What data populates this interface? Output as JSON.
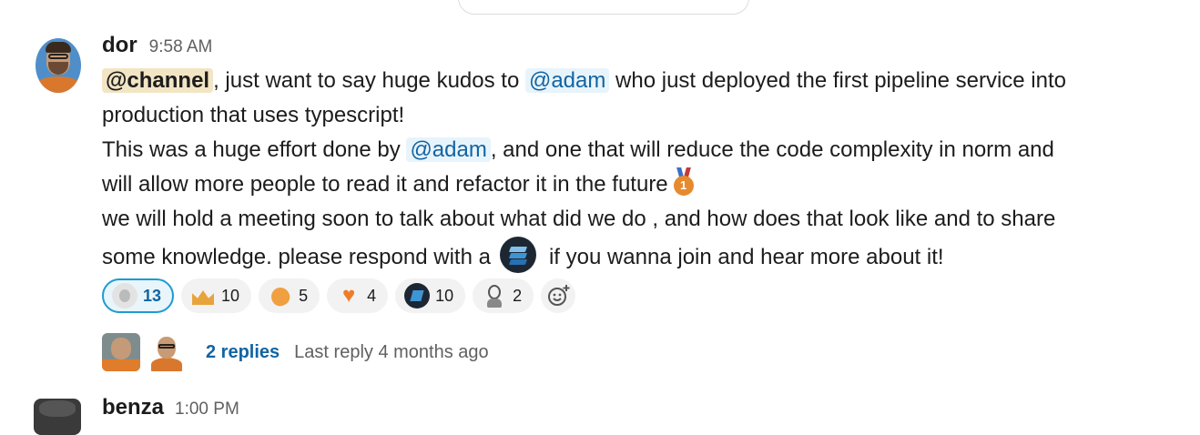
{
  "message": {
    "author": "dor",
    "time": "9:58 AM",
    "line1": {
      "mention_channel": "@channel",
      "text_a": ", just want to say huge kudos to ",
      "mention_user": "@adam",
      "text_b": " who just deployed the first pipeline service into"
    },
    "line2": "production that uses typescript!",
    "line3": {
      "text_a": "This was a huge effort done by ",
      "mention_user": "@adam",
      "text_b": ", and one that will reduce the code complexity in norm and"
    },
    "line4": "will allow more people to read it and refactor it in the future",
    "line5": "we will hold a meeting soon to talk about what did we do , and how does that look like and to share",
    "line6": {
      "text_a": "some knowledge. please respond with a",
      "text_b": "if you wanna join and hear more about it!"
    },
    "medal_number": "1"
  },
  "reactions": [
    {
      "icon": "face-emoji",
      "count": "13",
      "selected": true
    },
    {
      "icon": "crown-emoji",
      "count": "10"
    },
    {
      "icon": "clap-emoji",
      "count": "5"
    },
    {
      "icon": "orange-heart-emoji",
      "count": "4"
    },
    {
      "icon": "stack-emoji",
      "count": "10"
    },
    {
      "icon": "person-emoji",
      "count": "2"
    }
  ],
  "heart_glyph": "♥",
  "thread": {
    "replies": "2 replies",
    "last_reply": "Last reply 4 months ago"
  },
  "next_message": {
    "author": "benza",
    "time": "1:00 PM"
  },
  "colors": {
    "link": "#1264a3",
    "channel_mention_bg": "#f2e5c4",
    "user_mention_bg": "#e8f4fb",
    "selected_reaction_border": "#1d9bd1"
  }
}
